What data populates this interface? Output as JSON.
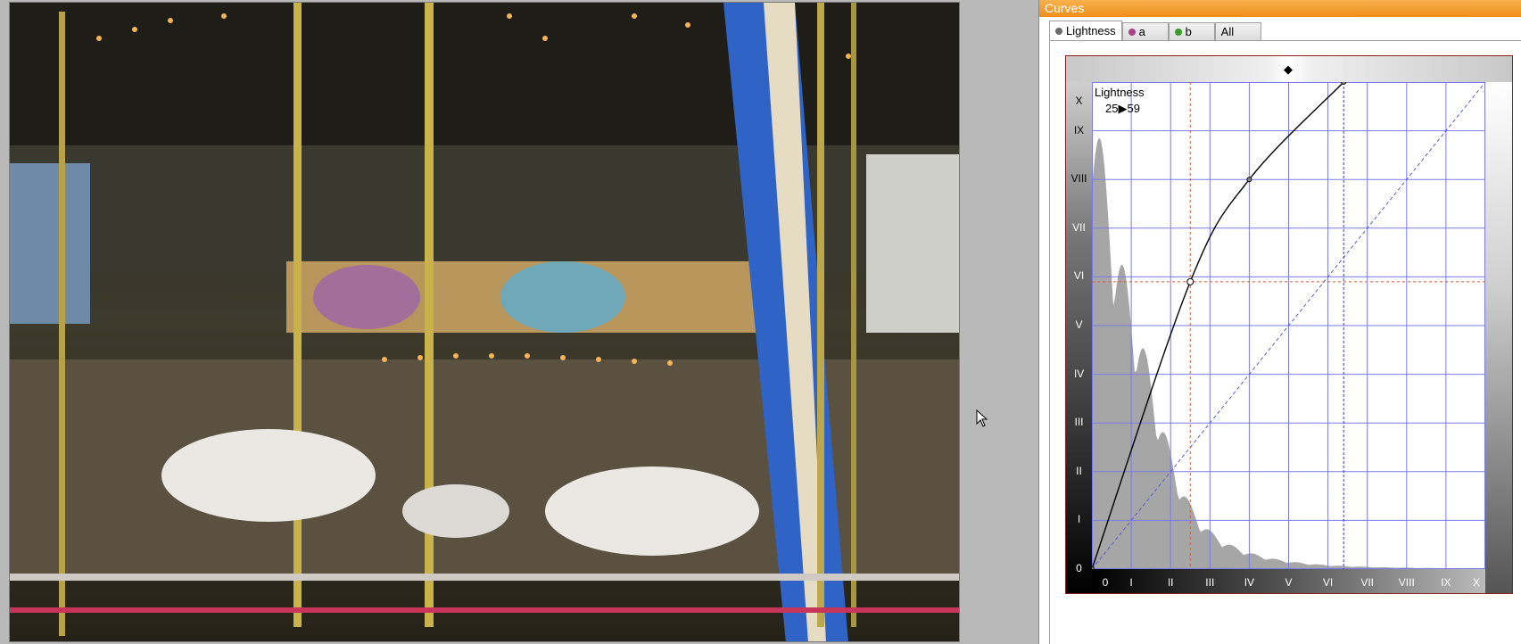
{
  "panel": {
    "title": "Curves"
  },
  "tabs": [
    {
      "label": "Lightness",
      "dot_color": "#6a6a6a"
    },
    {
      "label": "a",
      "dot_color": "#a8408a"
    },
    {
      "label": "b",
      "dot_color": "#3d9a2c"
    },
    {
      "label": "All",
      "dot_color": ""
    }
  ],
  "graph": {
    "channel_label": "Lightness",
    "readout": "25▶59",
    "y_axis_labels": [
      "X",
      "IX",
      "VIII",
      "VII",
      "VI",
      "V",
      "IV",
      "III",
      "II",
      "I",
      "0"
    ],
    "x_axis_labels": [
      "0",
      "I",
      "II",
      "III",
      "IV",
      "V",
      "VI",
      "VII",
      "VIII",
      "IX",
      "X"
    ],
    "control_points": [
      {
        "input": 0,
        "output": 0
      },
      {
        "input": 25,
        "output": 59
      },
      {
        "input": 40,
        "output": 80
      },
      {
        "input": 64,
        "output": 100
      }
    ],
    "guide_input": 25,
    "guide_output": 59,
    "white_point_input": 64,
    "grid_color": "#7a7ae6",
    "curve_color": "#000000",
    "histogram_color": "#a6a6a6"
  },
  "icons": {
    "cursor": "arrow-cursor-icon",
    "top_marker": "double-arrow-icon"
  }
}
